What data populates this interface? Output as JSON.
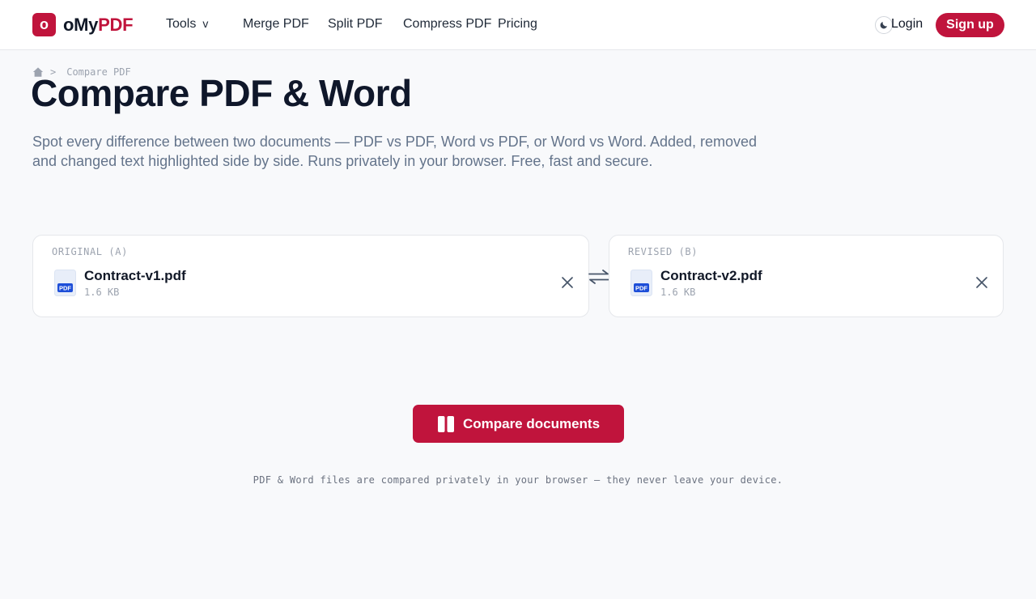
{
  "brand": {
    "logo_letter": "o",
    "name_prefix": "oMy",
    "name_accent": "PDF"
  },
  "nav": {
    "tools": "Tools",
    "tools_chevron": "v",
    "merge": "Merge PDF",
    "split": "Split PDF",
    "compress": "Compress PDF",
    "pricing": "Pricing"
  },
  "header": {
    "theme_icon": "moon-icon",
    "login": "Login",
    "signup": "Sign up"
  },
  "breadcrumb": {
    "separator": ">",
    "current": "Compare PDF"
  },
  "page": {
    "title": "Compare PDF & Word",
    "description": "Spot every difference between two documents — PDF vs PDF, Word vs PDF, or Word vs Word. Added, removed and changed text highlighted side by side. Runs privately in your browser. Free, fast and secure."
  },
  "files": {
    "original": {
      "label": "ORIGINAL (A)",
      "name": "Contract-v1.pdf",
      "size": "1.6 KB",
      "badge": "PDF"
    },
    "revised": {
      "label": "REVISED (B)",
      "name": "Contract-v2.pdf",
      "size": "1.6 KB",
      "badge": "PDF"
    }
  },
  "actions": {
    "compare": "Compare documents"
  },
  "footer_note": "PDF & Word files are compared privately in your browser — they never leave your device.",
  "colors": {
    "brand": "#c0143c",
    "title": "#0f172a",
    "muted": "#64748b",
    "pdf_badge": "#1d4ed8"
  }
}
